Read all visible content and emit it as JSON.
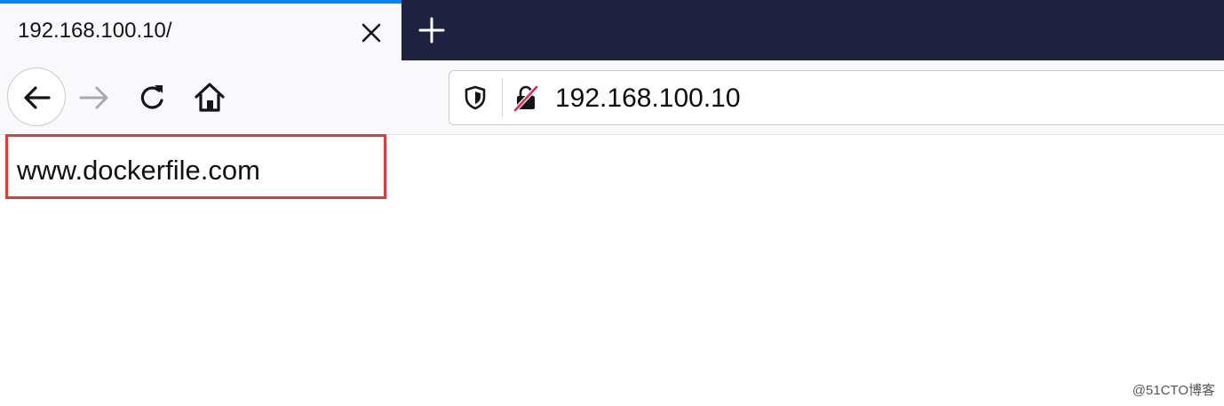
{
  "tab": {
    "title": "192.168.100.10/"
  },
  "toolbar": {
    "url": "192.168.100.10"
  },
  "page": {
    "body_text": "www.dockerfile.com"
  },
  "watermark": {
    "text": "@51CTO博客"
  },
  "colors": {
    "tab_accent": "#0a84ff",
    "tabstrip_bg": "#1f2140",
    "highlight_border": "#e0393e",
    "insecure_slash": "#e22850"
  },
  "icons": [
    "close-icon",
    "plus-icon",
    "back-arrow-icon",
    "forward-arrow-icon",
    "reload-icon",
    "home-icon",
    "tracking-shield-icon",
    "insecure-lock-icon"
  ]
}
